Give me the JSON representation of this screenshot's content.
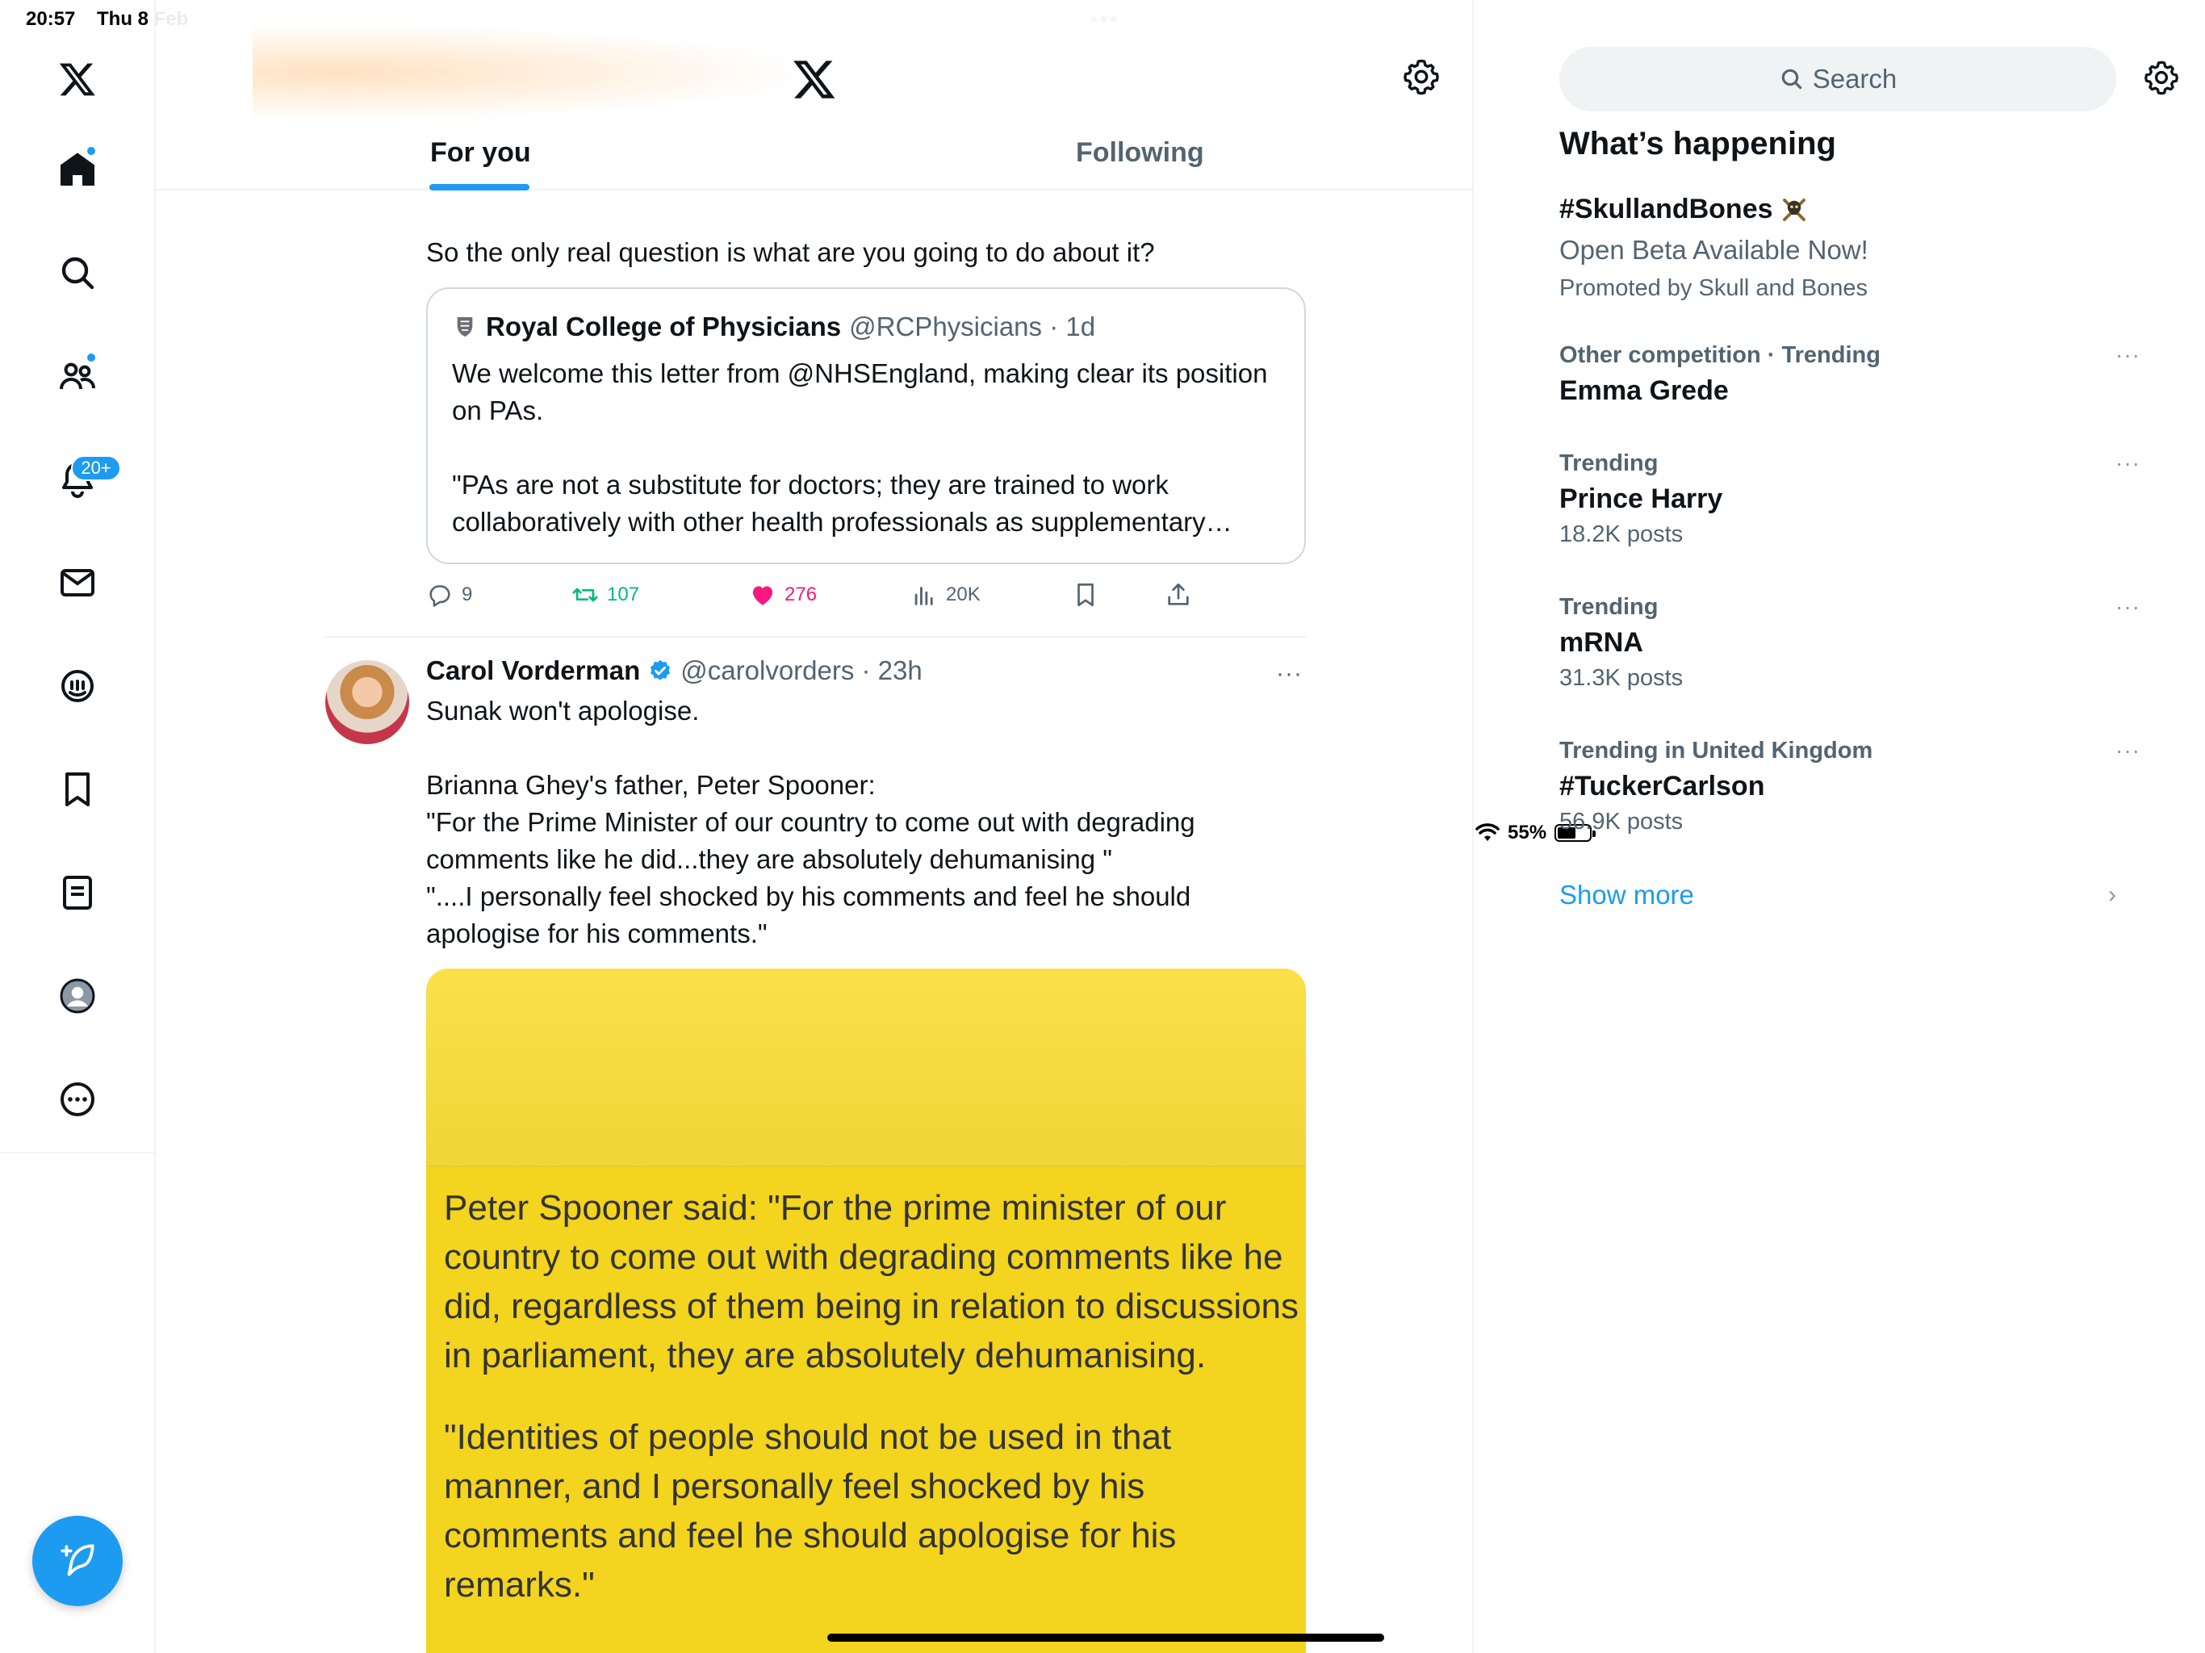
{
  "status": {
    "time": "20:57",
    "date": "Thu 8 Feb",
    "battery": "55%",
    "top_dots": "•••"
  },
  "nav": {
    "items": [
      "x-logo",
      "home",
      "explore",
      "communities",
      "notifications",
      "messages",
      "grok",
      "bookmarks",
      "lists",
      "profile",
      "more"
    ],
    "notif_count": "20+"
  },
  "header": {
    "tabs": [
      "For you",
      "Following"
    ],
    "active_tab": 0
  },
  "tweet1": {
    "text_tail": "So the only real question is what are you  going to do about it?",
    "quote": {
      "name": "Royal College of Physicians",
      "handle": "@RCPhysicians · 1d",
      "p1": "We welcome this letter from @NHSEngland, making clear its position on PAs.",
      "p2": "\"PAs are not a substitute for doctors; they are trained to work collaboratively with other health professionals as supplementary…"
    },
    "stats": {
      "replies": "9",
      "reposts": "107",
      "likes": "276",
      "views": "20K"
    }
  },
  "tweet2": {
    "name": "Carol Vorderman",
    "handle": "@carolvorders · 23h",
    "more": "···",
    "line1": "Sunak won't apologise.",
    "para2": "Brianna Ghey's father, Peter Spooner:\n\"For the Prime Minister of our country to come out with degrading comments like he did...they are absolutely dehumanising \"\n\"....I personally feel shocked by his comments and feel he should apologise for his comments.\"",
    "image_caption_1": "Peter Spooner said: \"For the prime minister of our country to come out with degrading comments like he did, regardless of them being in relation to discussions in parliament, they are absolutely dehumanising.",
    "image_caption_2": "\"Identities of people should not be used in that manner, and I personally feel shocked by his comments and feel he should apologise for his remarks.\""
  },
  "sidebar": {
    "search_placeholder": "Search",
    "title": "What’s happening",
    "promo": {
      "topic": "#SkullandBones",
      "subtitle": "Open Beta Available Now!",
      "by": "Promoted by Skull and Bones"
    },
    "trends": [
      {
        "meta": "Other competition · Trending",
        "topic": "Emma Grede",
        "count": ""
      },
      {
        "meta": "Trending",
        "topic": "Prince Harry",
        "count": "18.2K posts"
      },
      {
        "meta": "Trending",
        "topic": "mRNA",
        "count": "31.3K posts"
      },
      {
        "meta": "Trending in United Kingdom",
        "topic": "#TuckerCarlson",
        "count": "56.9K posts"
      }
    ],
    "more_dots": "···",
    "show_more": "Show more",
    "chevron": "›"
  },
  "colors": {
    "accent": "#1d9bf0",
    "repost": "#00ba7c",
    "like": "#f91880",
    "secondary_text": "#536471",
    "media_yellow": "#f3d41e"
  }
}
